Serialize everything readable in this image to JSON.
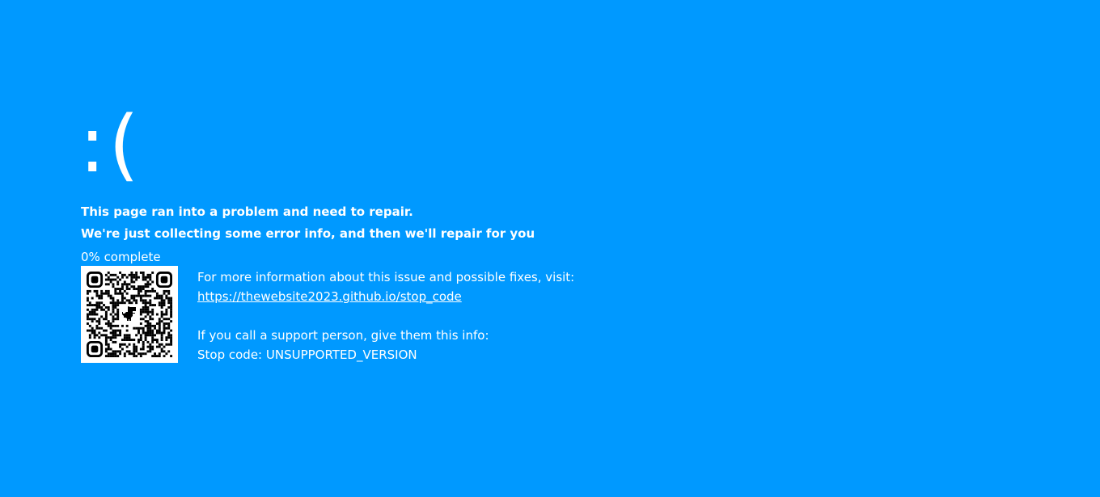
{
  "screen": {
    "background_color": "#0099ff",
    "text_color": "#ffffff"
  },
  "sad_face": ":(",
  "message": {
    "line1": "This page ran into a problem and need to repair.",
    "line2": "We're just collecting some error info, and then we'll repair for you"
  },
  "progress": {
    "text": "0% complete",
    "percent": 0
  },
  "qr_code": {
    "icon": "qr-code-icon",
    "center_icon": "dinosaur-icon"
  },
  "info": {
    "more_info_text": "For more information about this issue and possible fixes, visit:",
    "link_text": "https://thewebsite2023.github.io/stop_code",
    "support_text": "If you call a support person, give them this info:",
    "stop_code_text": "Stop code: UNSUPPORTED_VERSION"
  }
}
